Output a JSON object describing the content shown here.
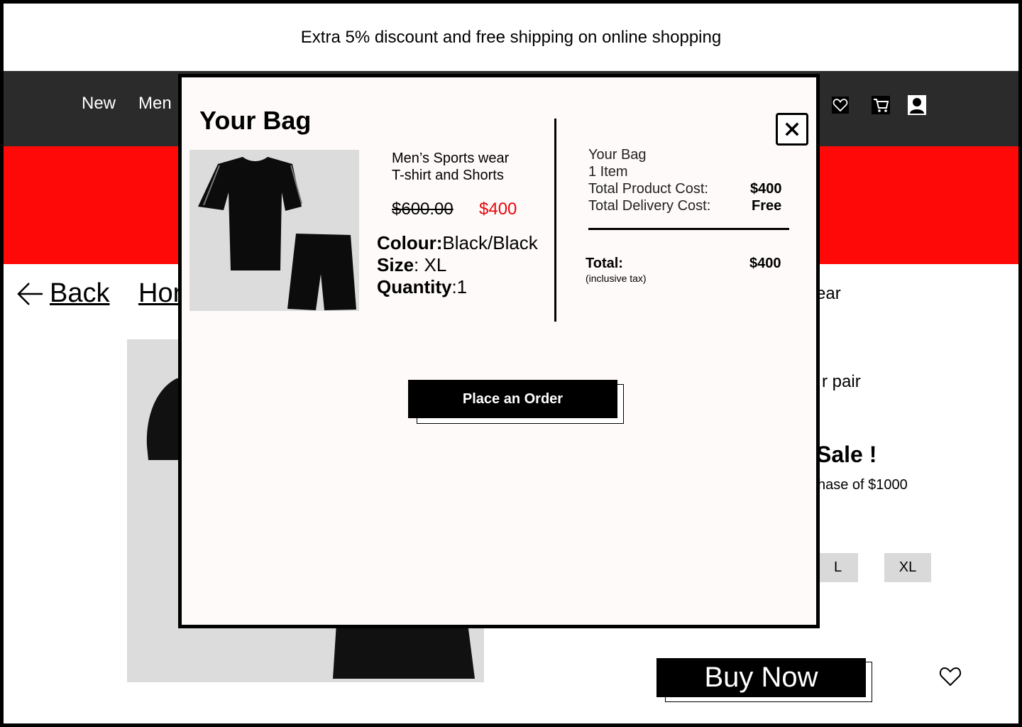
{
  "promo_text": "Extra 5% discount and free shipping on online shopping",
  "nav": {
    "items": [
      "New",
      "Men"
    ],
    "icons": [
      "heart-icon",
      "cart-icon",
      "user-icon"
    ]
  },
  "background": {
    "back_label": "Back",
    "home_label": "Hor",
    "breadcrumb_tail": "ear",
    "partial_price_text": "r pair",
    "sale_text": "Sale !",
    "purchase_text": "hase of $1000",
    "sizes": [
      "L",
      "XL"
    ],
    "buy_now_label": "Buy Now"
  },
  "bag": {
    "title": "Your Bag",
    "product": {
      "name_line1": "Men’s Sports wear",
      "name_line2": "T-shirt and Shorts",
      "old_price": "$600.00",
      "new_price": "$400",
      "colour_label": "Colour:",
      "colour_value": "Black/Black",
      "size_label": "Size",
      "size_value": ": XL",
      "quantity_label": "Quantity",
      "quantity_value": ":1"
    },
    "summary": {
      "heading": "Your Bag",
      "items": "1 Item",
      "product_cost_label": "Total Product Cost:",
      "product_cost_value": "$400",
      "delivery_cost_label": "Total Delivery Cost:",
      "delivery_cost_value": "Free",
      "total_label": "Total:",
      "total_note": "(inclusive tax)",
      "total_value": "$400"
    },
    "place_order_label": "Place an Order"
  },
  "colors": {
    "nav_bg": "#2b2b2b",
    "banner_red": "#ff0808",
    "price_red": "#e8060c",
    "modal_bg": "#fefaf9"
  }
}
